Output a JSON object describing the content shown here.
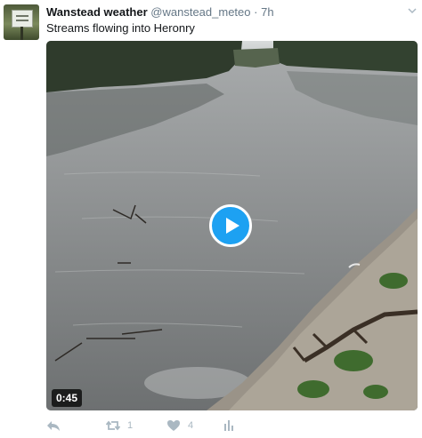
{
  "tweet": {
    "display_name": "Wanstead weather",
    "handle": "@wanstead_meteo",
    "separator": "·",
    "time": "7h",
    "text": "Streams flowing into Heronry"
  },
  "video": {
    "duration": "0:45"
  },
  "actions": {
    "reply_icon": "reply-icon",
    "retweet_icon": "retweet-icon",
    "retweet_count": "1",
    "like_icon": "heart-icon",
    "like_count": "4",
    "analytics_icon": "analytics-icon"
  },
  "colors": {
    "accent": "#1da1f2",
    "muted": "#aab8c2",
    "secondary_text": "#657786"
  }
}
